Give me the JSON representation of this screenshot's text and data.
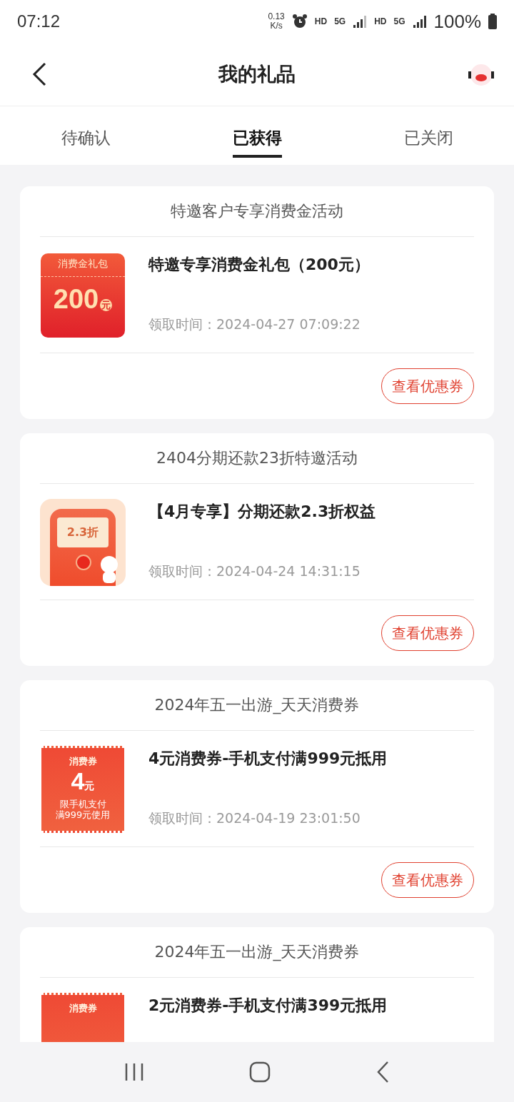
{
  "status_bar": {
    "time": "07:12",
    "speed_value": "0.13",
    "speed_unit": "K/s",
    "hd_1": "HD",
    "network_1": "5G",
    "hd_2": "HD",
    "network_2": "5G",
    "battery": "100%"
  },
  "header": {
    "title": "我的礼品"
  },
  "tabs": [
    {
      "label": "待确认",
      "selected": false
    },
    {
      "label": "已获得",
      "selected": true
    },
    {
      "label": "已关闭",
      "selected": false
    }
  ],
  "cards": [
    {
      "title": "特邀客户专享消费金活动",
      "item": "特邀专享消费金礼包（200元）",
      "thumb": {
        "kind": "package",
        "label": "消费金礼包",
        "amount": "200",
        "unit": "元"
      },
      "time_label": "领取时间：",
      "time": "2024-04-27 07:09:22",
      "button": "查看优惠券"
    },
    {
      "title": "2404分期还款23折特邀活动",
      "item": "【4月专享】分期还款2.3折权益",
      "thumb": {
        "kind": "redpacket",
        "label": "2.3折"
      },
      "time_label": "领取时间：",
      "time": "2024-04-24 14:31:15",
      "button": "查看优惠券"
    },
    {
      "title": "2024年五一出游_天天消费券",
      "item": "4元消费券-手机支付满999元抵用",
      "thumb": {
        "kind": "voucher",
        "label": "消费券",
        "amount": "4",
        "unit": "元",
        "note_1": "限手机支付",
        "note_2": "满999元使用"
      },
      "time_label": "领取时间：",
      "time": "2024-04-19 23:01:50",
      "button": "查看优惠券"
    },
    {
      "title": "2024年五一出游_天天消费券",
      "item": "2元消费券-手机支付满399元抵用",
      "thumb": {
        "kind": "voucher",
        "label": "消费券"
      }
    }
  ]
}
